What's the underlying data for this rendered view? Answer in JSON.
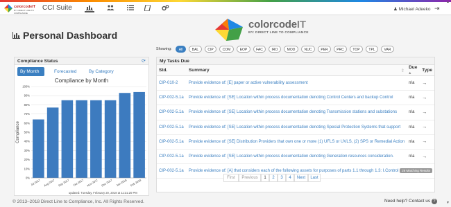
{
  "topbar": {
    "logo_text": "colorcodeIT",
    "logo_sub": "BY: DIRECT LINE TO COMPLIANCE",
    "app_title": "CCI Suite",
    "nav_icons": [
      "bar-chart-icon",
      "users-icon",
      "list-icon",
      "book-icon",
      "gears-icon"
    ],
    "user_name": "Michael Adeeko",
    "logout_icon": "sign-out-icon"
  },
  "brand": {
    "name_color": "color",
    "name_code": "code",
    "name_it": "IT",
    "tagline": "BY: DIRECT LINE TO COMPLIANCE"
  },
  "page": {
    "title": "Personal Dashboard"
  },
  "compliance": {
    "header": "Compliance Status",
    "tabs": [
      "By Month",
      "Forecasted",
      "By Category"
    ],
    "active_tab": "By Month",
    "updated": "updated: Tuesday, February 20, 2018 at 11:31:20 PM"
  },
  "chart_data": {
    "type": "bar",
    "title": "Compliance by Month",
    "ylabel": "Compliance",
    "xlabel": "",
    "categories": [
      "Jul 2017",
      "Aug 2017",
      "Sep 2017",
      "Oct 2017",
      "Nov 2017",
      "Dec 2017",
      "Jan 2018",
      "Feb 2018"
    ],
    "values": [
      64,
      77,
      85,
      85,
      85,
      85,
      93,
      94
    ],
    "ylim": [
      0,
      100
    ],
    "yticks": [
      "0%",
      "10%",
      "20%",
      "30%",
      "40%",
      "50%",
      "60%",
      "70%",
      "80%",
      "90%",
      "100%"
    ],
    "bar_color": "#3d7bbf",
    "grid": true
  },
  "filters": {
    "label": "Showing:",
    "pills": [
      "All",
      "BAL",
      "CIP",
      "COM",
      "EOP",
      "FAC",
      "IRO",
      "MOD",
      "NUC",
      "PER",
      "PRC",
      "TOP",
      "TPL",
      "VAR"
    ],
    "active": "All"
  },
  "tasks": {
    "header": "My Tasks Due",
    "columns": [
      "Std.",
      "Summary",
      "Due",
      "Type"
    ],
    "rows": [
      {
        "std": "CIP-010-2",
        "summary": "Provide evidence of: [E] paper or active vulnerability assessment",
        "due": "n/a",
        "type": "→"
      },
      {
        "std": "CIP-002-5.1a",
        "summary": "Provide evidence of: [SE] Location within process documentation denoting Control Centers and backup Control",
        "due": "n/a",
        "type": "→"
      },
      {
        "std": "CIP-002-5.1a",
        "summary": "Provide evidence of: [SE] Location within process documentation denoting Transmission stations and substations",
        "due": "n/a",
        "type": "→"
      },
      {
        "std": "CIP-002-5.1a",
        "summary": "Provide evidence of: [SE] Location within process documentation denoting Special Protection Systems that support",
        "due": "n/a",
        "type": "→"
      },
      {
        "std": "CIP-002-5.1a",
        "summary": "Provide evidence of: [SE] Distribution Providers that own one or more (1) UFLS or UVLS, (2) SPS or Remedial Action",
        "due": "n/a",
        "type": "→"
      },
      {
        "std": "CIP-002-5.1a",
        "summary": "Provide evidence of: [SE] Location within process documentation denoting Generation resources consideration.",
        "due": "n/a",
        "type": "→"
      },
      {
        "std": "CIP-002-5.1a",
        "summary": "Provide evidence of: [A] that considers each of the following assets for purposes of parts 1.1 through 1.3: I.Control",
        "due": "n/a",
        "type": "→"
      }
    ],
    "matching": "26 Matching Results",
    "pager": [
      "First",
      "Previous",
      "1",
      "2",
      "3",
      "4",
      "Next",
      "Last"
    ]
  },
  "footer": {
    "copyright": "© 2013–2018 Direct Line to Compliance, Inc. All Rights Reserved.",
    "help": "Need help? Contact us"
  }
}
